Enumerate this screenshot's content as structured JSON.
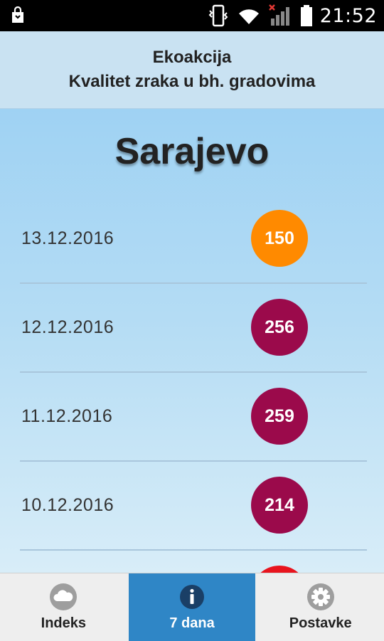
{
  "status_bar": {
    "time": "21:52",
    "icons": [
      "shopping-bag-icon",
      "phone-vibrate-icon",
      "wifi-icon",
      "no-signal-icon",
      "battery-icon"
    ]
  },
  "header": {
    "line1": "Ekoakcija",
    "line2": "Kvalitet zraka u bh. gradovima"
  },
  "city": "Sarajevo",
  "readings": [
    {
      "date": "13.12.2016",
      "value": "150",
      "color": "#ff8a00"
    },
    {
      "date": "12.12.2016",
      "value": "256",
      "color": "#9b0a4b"
    },
    {
      "date": "11.12.2016",
      "value": "259",
      "color": "#9b0a4b"
    },
    {
      "date": "10.12.2016",
      "value": "214",
      "color": "#9b0a4b"
    },
    {
      "date": "",
      "value": "",
      "color": "#e8141e"
    }
  ],
  "nav": {
    "tabs": [
      {
        "label": "Indeks",
        "icon": "cloud-icon",
        "active": false
      },
      {
        "label": "7 dana",
        "icon": "info-icon",
        "active": true
      },
      {
        "label": "Postavke",
        "icon": "gear-icon",
        "active": false
      }
    ]
  },
  "colors": {
    "accent": "#2f86c6",
    "header_bg": "#c9e2f2"
  }
}
